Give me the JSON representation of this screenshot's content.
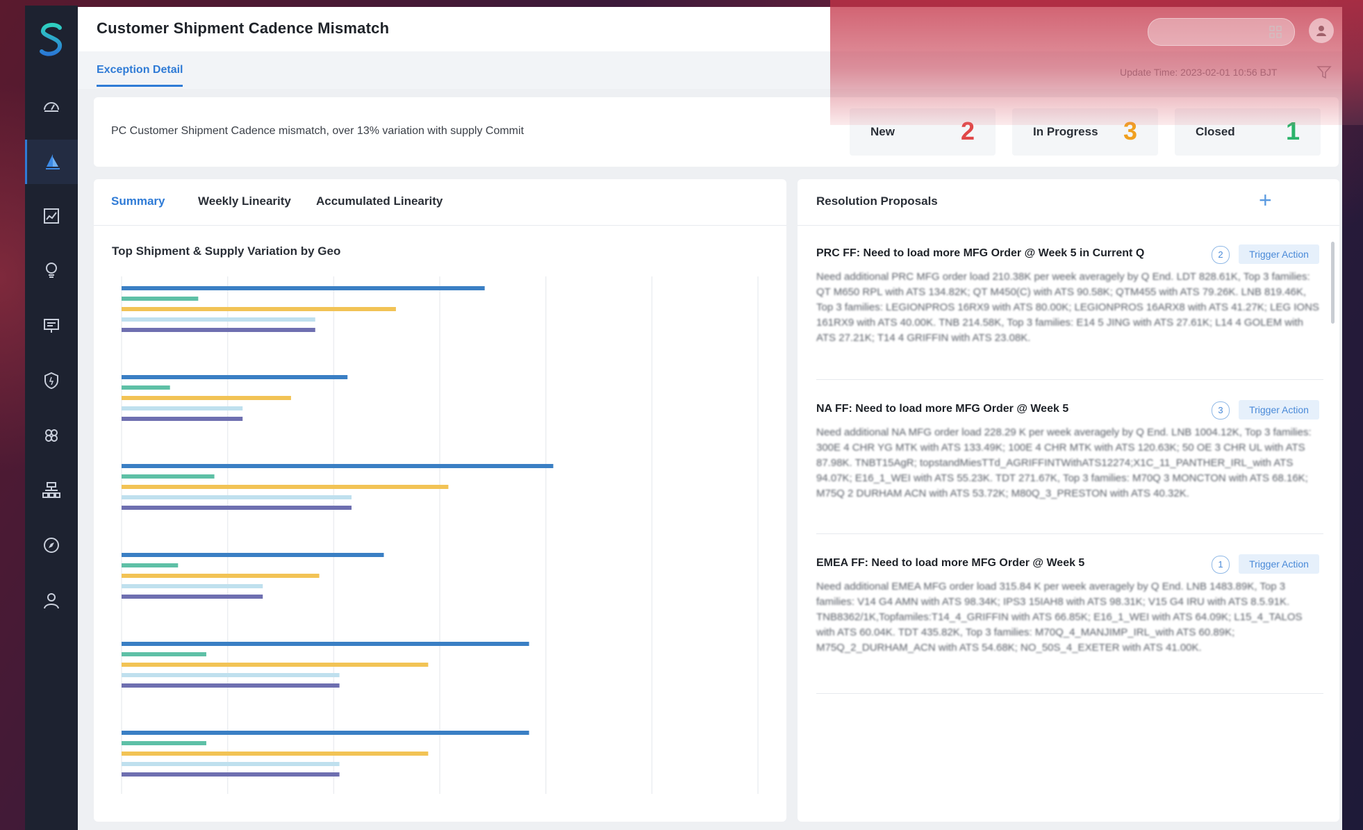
{
  "page": {
    "title": "Customer Shipment Cadence Mismatch",
    "tab": "Exception Detail",
    "update_time": "Update Time: 2023-02-01 10:56 BJT"
  },
  "summary": {
    "text": "PC Customer Shipment Cadence mismatch, over 13% variation with supply Commit",
    "stats": [
      {
        "label": "New",
        "count": "2",
        "color": "#e04848"
      },
      {
        "label": "In Progress",
        "count": "3",
        "color": "#f0a020"
      },
      {
        "label": "Closed",
        "count": "1",
        "color": "#2bb36a"
      }
    ]
  },
  "left_panel": {
    "tabs": [
      "Summary",
      "Weekly Linearity",
      "Accumulated Linearity"
    ],
    "active_tab": "Summary",
    "chart_title": "Top Shipment & Supply Variation by Geo"
  },
  "chart_data": {
    "type": "bar",
    "orientation": "horizontal",
    "title": "Top Shipment & Supply Variation by Geo",
    "grid": true,
    "series_colors": [
      "#3a7fc4",
      "#5ec0a6",
      "#f2c355",
      "#bfe0ee",
      "#6e6fb0"
    ],
    "groups": [
      [
        0.9,
        0.19,
        0.68,
        0.48,
        0.48
      ],
      [
        0.56,
        0.12,
        0.42,
        0.3,
        0.3
      ],
      [
        1.07,
        0.23,
        0.81,
        0.57,
        0.57
      ],
      [
        0.65,
        0.14,
        0.49,
        0.35,
        0.35
      ],
      [
        1.01,
        0.21,
        0.76,
        0.54,
        0.54
      ],
      [
        1.01,
        0.21,
        0.76,
        0.54,
        0.54
      ]
    ],
    "xlim": [
      0,
      1.2
    ],
    "gridlines": 6
  },
  "right_panel": {
    "title": "Resolution Proposals",
    "add_label": "+",
    "proposals": [
      {
        "title": "PRC FF: Need to load more MFG Order @ Week 5 in Current Q",
        "badge": "2",
        "action": "Trigger Action",
        "body": "Need additional PRC MFG order load 210.38K per week averagely by Q End. LDT 828.61K, Top 3 families: QT M650 RPL with ATS 134.82K; QT M450(C) with ATS 90.58K; QTM455 with ATS 79.26K. LNB 819.46K, Top 3 families: LEGIONPROS 16RX9 with ATS 80.00K; LEGIONPROS 16ARX8 with ATS 41.27K; LEG IONS 161RX9 with ATS 40.00K. TNB 214.58K, Top 3 families: E14 5 JING with ATS 27.61K; L14 4 GOLEM with ATS 27.21K; T14 4 GRIFFIN with ATS 23.08K."
      },
      {
        "title": "NA FF: Need to load more MFG Order @ Week 5",
        "badge": "3",
        "action": "Trigger Action",
        "body": "Need additional NA MFG order load 228.29 K per week averagely by Q End. LNB 1004.12K, Top 3 families: 300E 4 CHR YG MTK with ATS 133.49K; 100E 4 CHR MTK with ATS 120.63K; 50 OE 3 CHR UL with ATS 87.98K. TNBT15AgR; topstandMiesTTd_AGRIFFINTWithATS12274;X1C_11_PANTHER_IRL_with ATS 94.07K; E16_1_WEI with ATS 55.23K. TDT 271.67K, Top 3 families: M70Q 3 MONCTON with ATS 68.16K; M75Q 2 DURHAM ACN with ATS 53.72K; M80Q_3_PRESTON with ATS 40.32K."
      },
      {
        "title": "EMEA FF: Need to load more MFG Order @ Week 5",
        "badge": "1",
        "action": "Trigger Action",
        "body": "Need additional EMEA MFG order load 315.84 K per week averagely by Q End. LNB 1483.89K, Top 3 families: V14 G4 AMN with ATS 98.34K; IPS3 15IAH8 with ATS 98.31K; V15 G4 IRU with ATS 8.5.91K. TNB8362/1K,Topfamiles:T14_4_GRIFFIN with ATS 66.85K; E16_1_WEI with ATS 64.09K; L15_4_TALOS with ATS 60.04K. TDT 435.82K, Top 3 families: M70Q_4_MANJIMP_IRL_with ATS 60.89K; M75Q_2_DURHAM_ACN with ATS 54.68K; NO_50S_4_EXETER with ATS 41.00K."
      }
    ]
  },
  "sidebar": {
    "items": [
      "dashboard-icon",
      "sail-icon",
      "analytics-icon",
      "lightbulb-icon",
      "monitor-icon",
      "shield-icon",
      "community-icon",
      "hierarchy-icon",
      "compass-icon",
      "user-icon"
    ],
    "active_index": 1,
    "accent": "#2f7bd6"
  }
}
